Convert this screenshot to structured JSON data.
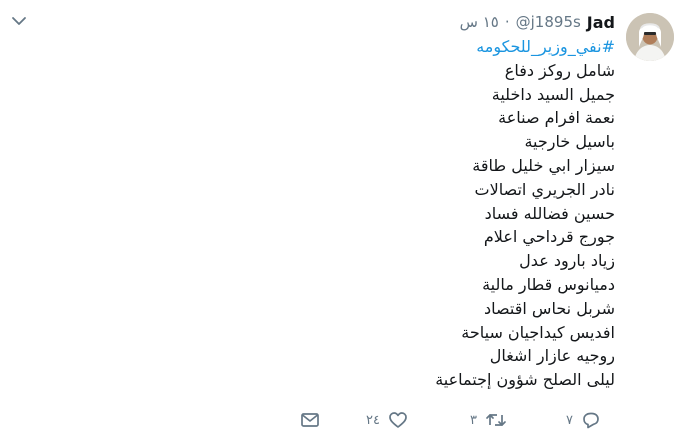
{
  "tweet": {
    "display_name": "Jad",
    "handle": "@j1895s",
    "separator": "·",
    "timestamp": "١٥ س",
    "hashtag": "#نفي_وزير_للحكومه",
    "lines": [
      "شامل روكز دفاع",
      "جميل السيد داخلية",
      "نعمة افرام صناعة",
      "باسيل خارجية",
      "سيزار ابي خليل طاقة",
      "نادر الجريري اتصالات",
      "حسين فضالله فساد",
      "جورج قرداحي اعلام",
      "زياد بارود عدل",
      "دميانوس قطار مالية",
      "شربل نحاس اقتصاد",
      "افديس كيداجيان سياحة",
      "روجيه عازار اشغال",
      "ليلى الصلح شؤون إجتماعية"
    ]
  },
  "actions": {
    "reply_count": "٧",
    "retweet_count": "٣",
    "like_count": "٢٤"
  },
  "colors": {
    "link": "#1b95e0",
    "muted": "#657786",
    "text": "#14171a"
  },
  "icons": [
    "chevron-down-icon",
    "reply-icon",
    "retweet-icon",
    "like-icon",
    "message-icon"
  ]
}
